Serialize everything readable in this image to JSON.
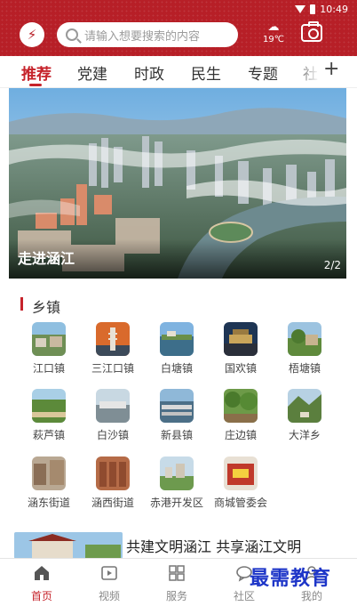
{
  "status_bar": {
    "time": "10:49"
  },
  "header": {
    "search": {
      "placeholder": "请输入想要搜索的内容"
    },
    "weather": {
      "icon": "cloud-icon",
      "temperature": "19℃"
    }
  },
  "tabs": [
    {
      "label": "推荐",
      "active": true
    },
    {
      "label": "党建"
    },
    {
      "label": "时政"
    },
    {
      "label": "民生"
    },
    {
      "label": "专题"
    },
    {
      "label": "社"
    }
  ],
  "banner": {
    "caption": "走进涵江",
    "pager": "2/2"
  },
  "section": {
    "title": "乡镇"
  },
  "towns": [
    {
      "label": "江口镇"
    },
    {
      "label": "三江口镇"
    },
    {
      "label": "白塘镇"
    },
    {
      "label": "国欢镇"
    },
    {
      "label": "梧塘镇"
    },
    {
      "label": "萩芦镇"
    },
    {
      "label": "白沙镇"
    },
    {
      "label": "新县镇"
    },
    {
      "label": "庄边镇"
    },
    {
      "label": "大洋乡"
    },
    {
      "label": "涵东街道"
    },
    {
      "label": "涵西街道"
    },
    {
      "label": "赤港开发区"
    },
    {
      "label": "商城管委会"
    }
  ],
  "news": {
    "title": "共建文明涵江 共享涵江文明"
  },
  "bottom_nav": [
    {
      "label": "首页",
      "icon": "home-icon",
      "active": true
    },
    {
      "label": "视频",
      "icon": "video-icon"
    },
    {
      "label": "服务",
      "icon": "grid-icon"
    },
    {
      "label": "社区",
      "icon": "chat-icon"
    },
    {
      "label": "我的",
      "icon": "user-icon"
    }
  ],
  "watermark": "最需教育",
  "colors": {
    "brand_red": "#b71f27",
    "accent_red": "#c6232b"
  }
}
